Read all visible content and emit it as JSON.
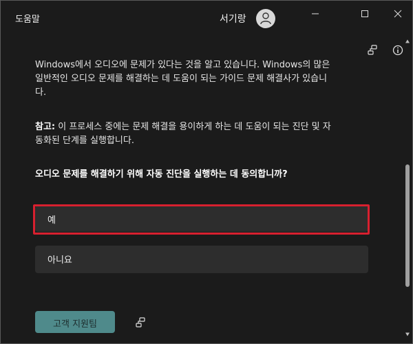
{
  "window": {
    "title": "도움말",
    "user_name": "서기랑"
  },
  "content": {
    "intro_text": "Windows에서 오디오에 문제가 있다는 것을 알고 있습니다. Windows의 많은 일반적인 오디오 문제를 해결하는 데 도움이 되는 가이드 문제 해결사가 있습니다.",
    "note_label": "참고:",
    "note_text": " 이 프로세스 중에는 문제 해결을 용이하게 하는 데 도움이 되는 진단 및 자동화된 단계를 실행합니다.",
    "question": "오디오 문제를 해결하기 위해 자동 진단을 실행하는 데 동의합니까?",
    "options": [
      {
        "label": "예"
      },
      {
        "label": "아니요"
      }
    ]
  },
  "footer": {
    "support_label": "고객 지원팀"
  },
  "colors": {
    "background": "#1b1b1b",
    "option_bg": "#2d2d2d",
    "highlight": "#d8202f",
    "support_button": "#4f8a8b"
  }
}
